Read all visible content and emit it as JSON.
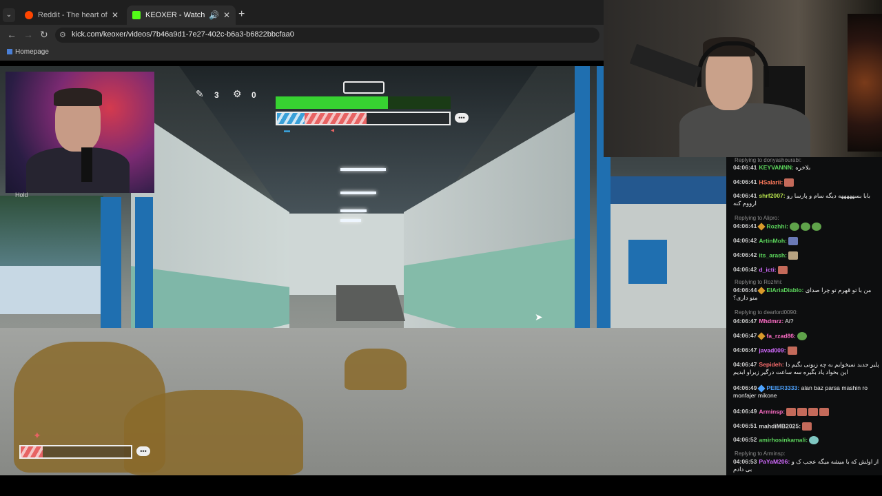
{
  "browser": {
    "tabs": [
      {
        "title": "Reddit - The heart of the internet",
        "favicon_color": "#ff4500"
      },
      {
        "title": "KEOXER - Watch the VOD on Kick",
        "favicon_color": "#53fc18"
      }
    ],
    "url": "kick.com/keoxer/videos/7b46a9d1-7e27-402c-b6a3-b6822bbcfaa0",
    "bookmark": "Homepage"
  },
  "webcam_hint": "Hold",
  "hud": {
    "item1_count": "3",
    "item2_count": "0",
    "health_fraction": 0.64,
    "boost_fraction": 0.52,
    "player_fraction": 0.2
  },
  "chat": {
    "messages": [
      {
        "reply_to": "Replying to donyashourabi:",
        "time": "04:06:41",
        "user": "KEYVANNN:",
        "color": "#5cd65c",
        "text": "بلاخره"
      },
      {
        "time": "04:06:41",
        "user": "HSalarii:",
        "color": "#ff7a5c",
        "text": ""
      },
      {
        "time": "04:06:41",
        "user": "shrf2007:",
        "color": "#b8e34d",
        "text": "بابا بسهههههه دیگه سام و پارسا رو ارووم کنه"
      },
      {
        "reply_to": "Replying to Alipro:",
        "time": "04:06:41",
        "user": "Rozhhi:",
        "color": "#5cd65c",
        "text": ""
      },
      {
        "time": "04:06:42",
        "user": "ArtinMoh:",
        "color": "#5cd65c",
        "text": ""
      },
      {
        "time": "04:06:42",
        "user": "its_arash:",
        "color": "#5cd65c",
        "text": ""
      },
      {
        "time": "04:06:42",
        "user": "d_icti:",
        "color": "#d36bff",
        "text": ""
      },
      {
        "reply_to": "Replying to Rozhhi:",
        "time": "04:06:44",
        "user": "ElAriaDiablo:",
        "color": "#5cd65c",
        "text": "من با تو قهرم تو چرا صدای منو داری؟"
      },
      {
        "reply_to": "Replying to dearlord0090:",
        "time": "04:06:47",
        "user": "Mhdmrz:",
        "color": "#ff6ec7",
        "text": "Ai?"
      },
      {
        "time": "04:06:47",
        "user": "fa_rzad86:",
        "color": "#ff6ec7",
        "text": ""
      },
      {
        "time": "04:06:47",
        "user": "javad009:",
        "color": "#d36bff",
        "text": ""
      },
      {
        "time": "04:06:47",
        "user": "Sepideh:",
        "color": "#ff6e6e",
        "text": "پلیر جدید نمیخوایم به چه زبونی بگیم دا این بخواد یاد بگیره سه ساعت درگیر زیراو ابدیم"
      },
      {
        "time": "04:06:49",
        "user": "PEIER3333:",
        "color": "#4da3ff",
        "text": "alan baz parsa mashin ro monfajer mikone"
      },
      {
        "time": "04:06:49",
        "user": "Arminsp:",
        "color": "#ff6ec7",
        "text": ""
      },
      {
        "time": "04:06:51",
        "user": "mahdiMB2025:",
        "color": "#d8d8d8",
        "text": ""
      },
      {
        "time": "04:06:52",
        "user": "amirhosinkamali:",
        "color": "#5cd65c",
        "text": ""
      },
      {
        "reply_to": "Replying to Arminsp:",
        "time": "04:06:53",
        "user": "PaYaM206:",
        "color": "#d36bff",
        "text": "از اولش که با میشه میگه عجب ک و بی دادم"
      }
    ]
  }
}
